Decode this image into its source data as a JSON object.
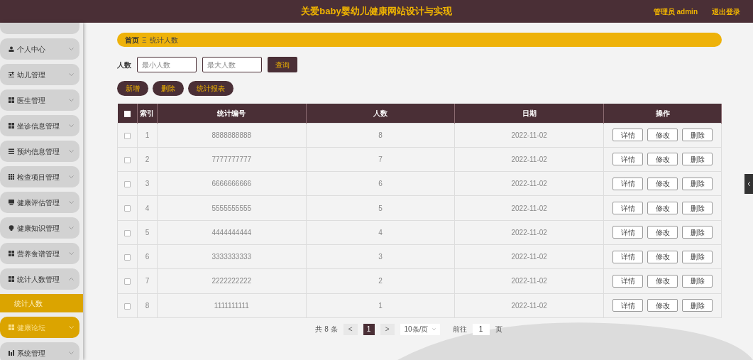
{
  "header": {
    "title": "关爱baby婴幼儿健康网站设计与实现",
    "user": "管理员 admin",
    "logout": "退出登录"
  },
  "sidebar": {
    "items": [
      {
        "label": "个人中心",
        "expanded": false,
        "hovered": false
      },
      {
        "label": "幼儿管理",
        "expanded": false,
        "hovered": false
      },
      {
        "label": "医生管理",
        "expanded": false,
        "hovered": false
      },
      {
        "label": "坐诊信息管理",
        "expanded": false,
        "hovered": false
      },
      {
        "label": "预约信息管理",
        "expanded": false,
        "hovered": false
      },
      {
        "label": "检查项目管理",
        "expanded": false,
        "hovered": false
      },
      {
        "label": "健康评估管理",
        "expanded": false,
        "hovered": false
      },
      {
        "label": "健康知识管理",
        "expanded": false,
        "hovered": false
      },
      {
        "label": "营养食谱管理",
        "expanded": false,
        "hovered": false
      },
      {
        "label": "统计人数管理",
        "expanded": true,
        "hovered": false,
        "children": [
          {
            "label": "统计人数",
            "selected": true
          }
        ]
      },
      {
        "label": "健康论坛",
        "expanded": false,
        "hovered": true
      },
      {
        "label": "系统管理",
        "expanded": false,
        "hovered": false
      }
    ]
  },
  "breadcrumb": {
    "home": "首页",
    "separator": "Ξ",
    "current": "统计人数"
  },
  "search": {
    "label": "人数",
    "min_placeholder": "最小人数",
    "max_placeholder": "最大人数",
    "button": "查询"
  },
  "actions": [
    "新增",
    "删除",
    "统计报表"
  ],
  "table": {
    "select_all_checked": false,
    "columns": [
      "索引",
      "统计编号",
      "人数",
      "日期",
      "操作"
    ],
    "rows": [
      {
        "index": "1",
        "code": "8888888888",
        "count": "8",
        "date": "2022-11-02",
        "checked": false,
        "buttons": [
          "详情",
          "修改",
          "删除"
        ]
      },
      {
        "index": "2",
        "code": "7777777777",
        "count": "7",
        "date": "2022-11-02",
        "checked": false,
        "buttons": [
          "详情",
          "修改",
          "删除"
        ]
      },
      {
        "index": "3",
        "code": "6666666666",
        "count": "6",
        "date": "2022-11-02",
        "checked": false,
        "buttons": [
          "详情",
          "修改",
          "删除"
        ]
      },
      {
        "index": "4",
        "code": "5555555555",
        "count": "5",
        "date": "2022-11-02",
        "checked": false,
        "buttons": [
          "详情",
          "修改",
          "删除"
        ]
      },
      {
        "index": "5",
        "code": "4444444444",
        "count": "4",
        "date": "2022-11-02",
        "checked": false,
        "buttons": [
          "详情",
          "修改",
          "删除"
        ]
      },
      {
        "index": "6",
        "code": "3333333333",
        "count": "3",
        "date": "2022-11-02",
        "checked": false,
        "buttons": [
          "详情",
          "修改",
          "删除"
        ]
      },
      {
        "index": "7",
        "code": "2222222222",
        "count": "2",
        "date": "2022-11-02",
        "checked": false,
        "buttons": [
          "详情",
          "修改",
          "删除"
        ]
      },
      {
        "index": "8",
        "code": "1111111111",
        "count": "1",
        "date": "2022-11-02",
        "checked": false,
        "buttons": [
          "详情",
          "修改",
          "删除"
        ]
      }
    ]
  },
  "pagination": {
    "total": "共 8 条",
    "prev": "<",
    "pages": [
      {
        "label": "1",
        "selected": true
      }
    ],
    "next": ">",
    "page_size": "10条/页",
    "goto_label": "前往",
    "goto_value": "1",
    "goto_suffix": "页"
  }
}
